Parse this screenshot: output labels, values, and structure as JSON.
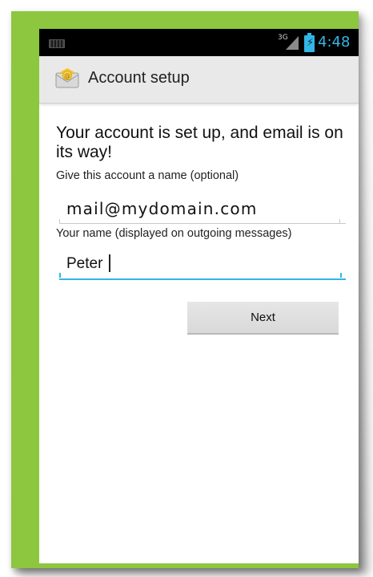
{
  "status_bar": {
    "network": "3G",
    "time": "4:48",
    "icons": [
      "keyboard-icon",
      "signal-icon",
      "battery-charging-icon"
    ]
  },
  "action_bar": {
    "title": "Account setup",
    "icon": "email-envelope-icon"
  },
  "content": {
    "heading": "Your account is set up, and email is on its way!",
    "account_name_label": "Give this account a name (optional)",
    "account_name_value": "mail@mydomain.com",
    "your_name_label": "Your name (displayed on outgoing messages)",
    "your_name_value": "Peter",
    "next_label": "Next"
  },
  "colors": {
    "frame": "#8dc63f",
    "accent": "#33b5e5",
    "action_bar": "#e9e9e9",
    "status_bar": "#000000"
  }
}
